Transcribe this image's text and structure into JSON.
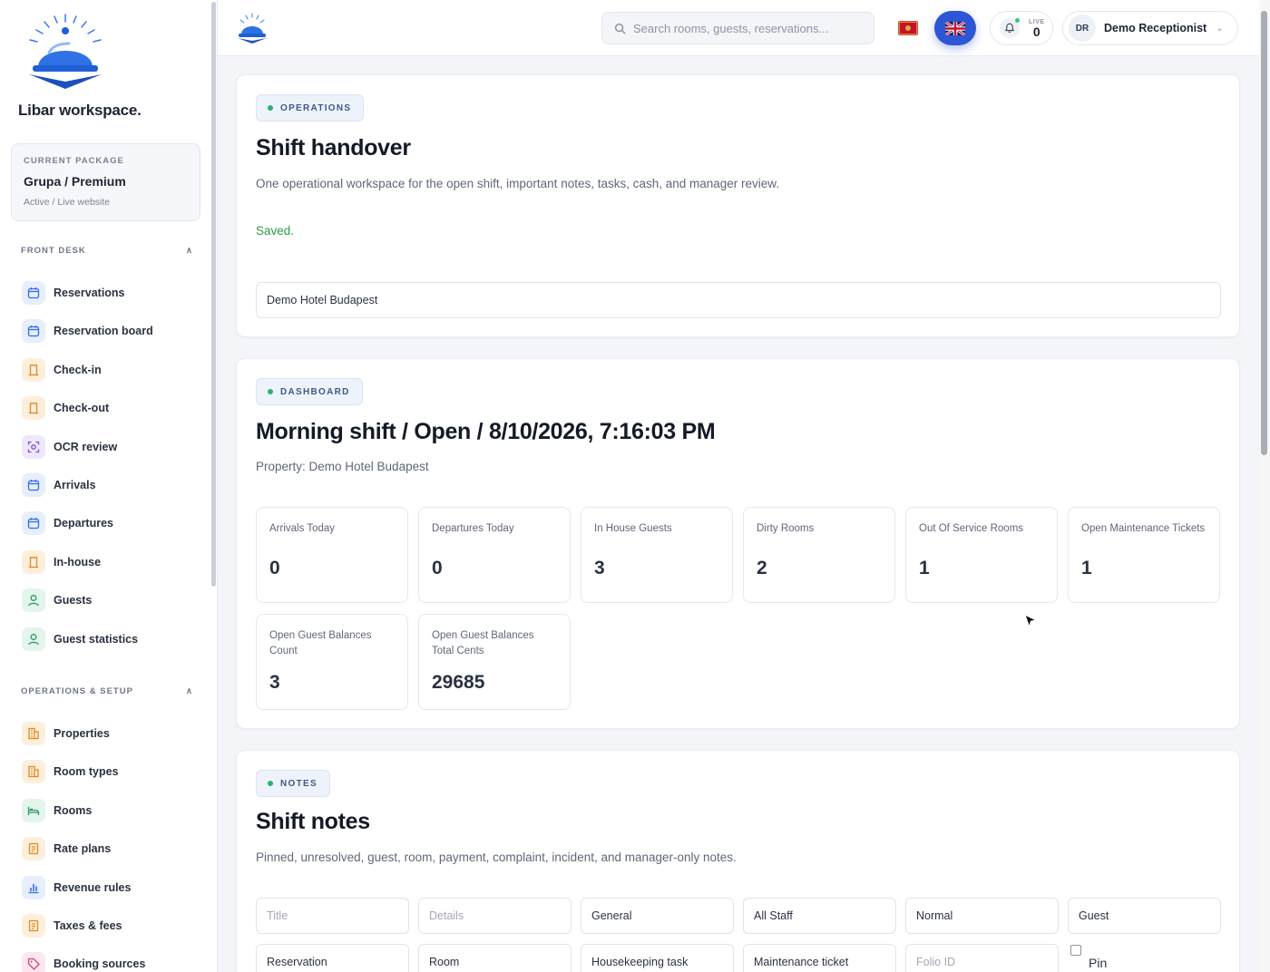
{
  "sidebar": {
    "brand": "Libar workspace.",
    "package": {
      "caption": "CURRENT PACKAGE",
      "name": "Grupa / Premium",
      "status": "Active / Live website"
    },
    "sections": [
      {
        "title": "FRONT DESK",
        "toggle": "∧",
        "items": [
          {
            "label": "Reservations",
            "icon": "calendar-icon",
            "color": "blue"
          },
          {
            "label": "Reservation board",
            "icon": "calendar-icon",
            "color": "blue"
          },
          {
            "label": "Check-in",
            "icon": "door-icon",
            "color": "orange"
          },
          {
            "label": "Check-out",
            "icon": "door-icon",
            "color": "orange"
          },
          {
            "label": "OCR review",
            "icon": "scan-icon",
            "color": "purple"
          },
          {
            "label": "Arrivals",
            "icon": "calendar-icon",
            "color": "blue"
          },
          {
            "label": "Departures",
            "icon": "calendar-icon",
            "color": "blue"
          },
          {
            "label": "In-house",
            "icon": "door-icon",
            "color": "orange"
          },
          {
            "label": "Guests",
            "icon": "user-icon",
            "color": "green"
          },
          {
            "label": "Guest statistics",
            "icon": "user-icon",
            "color": "green"
          }
        ]
      },
      {
        "title": "OPERATIONS & SETUP",
        "toggle": "∧",
        "items": [
          {
            "label": "Properties",
            "icon": "building-icon",
            "color": "orange"
          },
          {
            "label": "Room types",
            "icon": "building-icon",
            "color": "orange"
          },
          {
            "label": "Rooms",
            "icon": "bed-icon",
            "color": "green"
          },
          {
            "label": "Rate plans",
            "icon": "document-icon",
            "color": "orange"
          },
          {
            "label": "Revenue rules",
            "icon": "bar-chart-icon",
            "color": "blue"
          },
          {
            "label": "Taxes & fees",
            "icon": "document-icon",
            "color": "orange"
          },
          {
            "label": "Booking sources",
            "icon": "tag-icon",
            "color": "pink"
          }
        ]
      }
    ]
  },
  "topbar": {
    "search_placeholder": "Search rooms, guests, reservations...",
    "live_caption": "LIVE",
    "live_count": "0",
    "user_initials": "DR",
    "user_name": "Demo Receptionist"
  },
  "operations": {
    "badge": "OPERATIONS",
    "title": "Shift handover",
    "description": "One operational workspace for the open shift, important notes, tasks, cash, and manager review.",
    "status": "Saved.",
    "property_value": "Demo Hotel Budapest"
  },
  "dashboard": {
    "badge": "DASHBOARD",
    "title": "Morning shift / Open / 8/10/2026, 7:16:03 PM",
    "property_line": "Property: Demo Hotel Budapest",
    "stats": [
      {
        "label": "Arrivals Today",
        "value": "0"
      },
      {
        "label": "Departures Today",
        "value": "0"
      },
      {
        "label": "In House Guests",
        "value": "3"
      },
      {
        "label": "Dirty Rooms",
        "value": "2"
      },
      {
        "label": "Out Of Service Rooms",
        "value": "1"
      },
      {
        "label": "Open Maintenance Tickets",
        "value": "1"
      },
      {
        "label": "Open Guest Balances Count",
        "value": "3"
      },
      {
        "label": "Open Guest Balances Total Cents",
        "value": "29685"
      }
    ]
  },
  "notes": {
    "badge": "NOTES",
    "title": "Shift notes",
    "description": "Pinned, unresolved, guest, room, payment, complaint, incident, and manager-only notes.",
    "row1": [
      {
        "placeholder": "Title"
      },
      {
        "placeholder": "Details"
      },
      {
        "value": "General"
      },
      {
        "value": "All Staff"
      },
      {
        "value": "Normal"
      },
      {
        "value": "Guest"
      }
    ],
    "row2": [
      {
        "value": "Reservation"
      },
      {
        "value": "Room"
      },
      {
        "value": "Housekeeping task"
      },
      {
        "value": "Maintenance ticket"
      },
      {
        "placeholder": "Folio ID"
      }
    ],
    "pin_label": "Pin"
  }
}
